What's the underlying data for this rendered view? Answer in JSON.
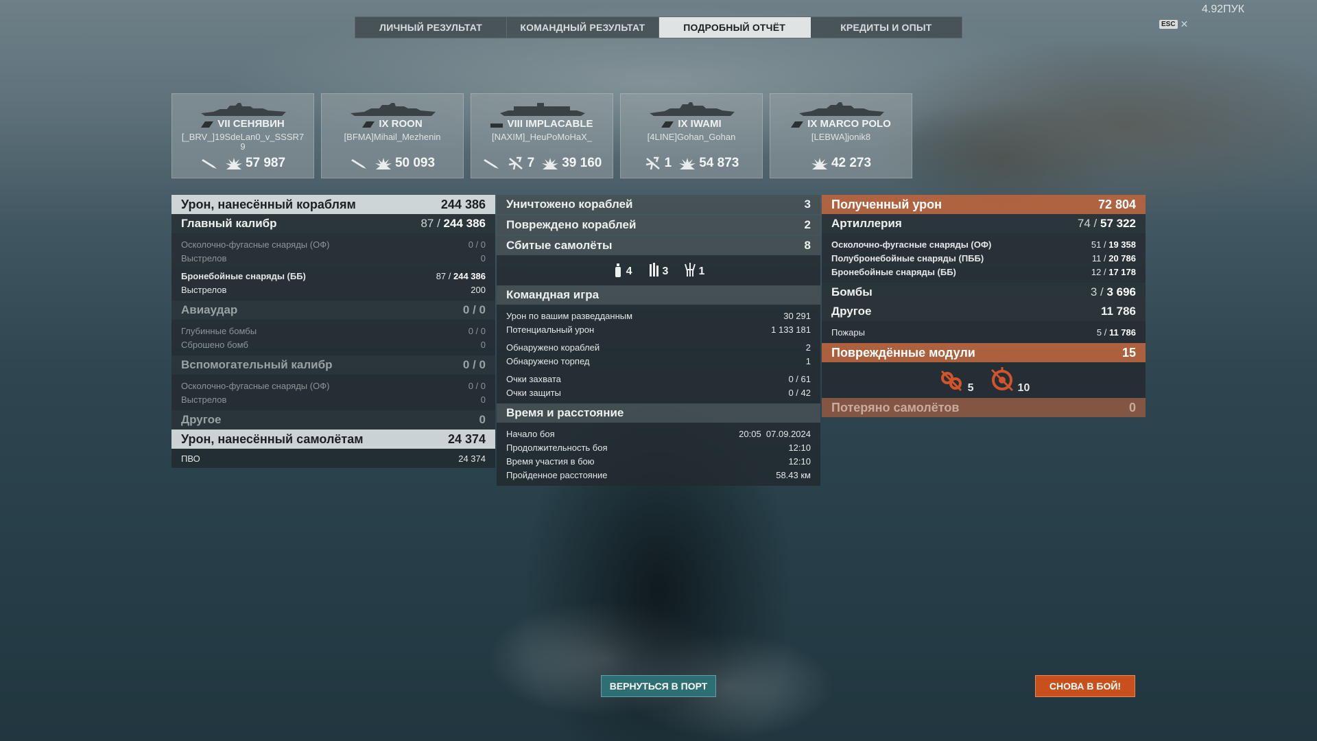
{
  "version": "4.92ПУК",
  "tabs": [
    {
      "label": "ЛИЧНЫЙ РЕЗУЛЬТАТ"
    },
    {
      "label": "КОМАНДНЫЙ РЕЗУЛЬТАТ"
    },
    {
      "label": "ПОДРОБНЫЙ ОТЧЁТ"
    },
    {
      "label": "КРЕДИТЫ И ОПЫТ"
    }
  ],
  "esc_label": "ESC",
  "ships": [
    {
      "name": "VII СЕНЯВИН",
      "player": "[_BRV_]19SdeLan0_v_SSSR79",
      "torpedo": "",
      "planes": "",
      "damage": "57 987"
    },
    {
      "name": "IX ROON",
      "player": "[BFMA]Mihail_Mezhenin",
      "torpedo": "",
      "planes": "",
      "damage": "50 093"
    },
    {
      "name": "VIII IMPLACABLE",
      "player": "[NAXIM]_HeuPoMoHaX_",
      "torpedo": "",
      "planes": "7",
      "damage": "39 160"
    },
    {
      "name": "IX IWAMI",
      "player": "[4LINE]Gohan_Gohan",
      "torpedo": "",
      "planes": "1",
      "damage": "54 873"
    },
    {
      "name": "IX MARCO POLO",
      "player": "[LEBWA]jonik8",
      "torpedo": "",
      "planes": "",
      "damage": "42 273"
    }
  ],
  "left": {
    "damage_ships_label": "Урон, нанесённый кораблям",
    "damage_ships_value": "244 386",
    "main_caliber_label": "Главный калибр",
    "main_caliber_hits": "87",
    "main_caliber_damage": "244 386",
    "he_label": "Осколочно-фугасные снаряды (ОФ)",
    "he_value": "0 / 0",
    "he_shots_label": "Выстрелов",
    "he_shots_value": "0",
    "ap_label": "Бронебойные снаряды (ББ)",
    "ap_hits": "87",
    "ap_damage": "244 386",
    "ap_shots_label": "Выстрелов",
    "ap_shots_value": "200",
    "airstrike_label": "Авиаудар",
    "airstrike_value": "0 / 0",
    "depth_label": "Глубинные бомбы",
    "depth_value": "0 / 0",
    "bombs_dropped_label": "Сброшено бомб",
    "bombs_dropped_value": "0",
    "secondary_label": "Вспомогательный калибр",
    "secondary_value": "0 / 0",
    "sec_he_label": "Осколочно-фугасные снаряды (ОФ)",
    "sec_he_value": "0 / 0",
    "sec_shots_label": "Выстрелов",
    "sec_shots_value": "0",
    "other_label": "Другое",
    "other_value": "0",
    "damage_planes_label": "Урон, нанесённый самолётам",
    "damage_planes_value": "24 374",
    "aa_label": "ПВО",
    "aa_value": "24 374"
  },
  "middle": {
    "destroyed_label": "Уничтожено кораблей",
    "destroyed_value": "3",
    "damaged_label": "Повреждено кораблей",
    "damaged_value": "2",
    "planes_label": "Сбитые самолёты",
    "planes_value": "8",
    "plane_types": [
      {
        "count": "4"
      },
      {
        "count": "3"
      },
      {
        "count": "1"
      }
    ],
    "teamplay_label": "Командная игра",
    "spotting_damage_label": "Урон по вашим разведданным",
    "spotting_damage_value": "30 291",
    "potential_label": "Потенциальный урон",
    "potential_value": "1 133 181",
    "spotted_ships_label": "Обнаружено кораблей",
    "spotted_ships_value": "2",
    "spotted_torps_label": "Обнаружено торпед",
    "spotted_torps_value": "1",
    "capture_label": "Очки захвата",
    "capture_value": "0 / 61",
    "defense_label": "Очки защиты",
    "defense_value": "0 / 42",
    "time_label": "Время и расстояние",
    "start_label": "Начало боя",
    "start_value": "20:05  07.09.2024",
    "duration_label": "Продолжительность боя",
    "duration_value": "12:10",
    "participation_label": "Время участия в бою",
    "participation_value": "12:10",
    "distance_label": "Пройденное расстояние",
    "distance_value": "58.43 км"
  },
  "right": {
    "received_label": "Полученный урон",
    "received_value": "72 804",
    "artillery_label": "Артиллерия",
    "artillery_hits": "74",
    "artillery_damage": "57 322",
    "he_label": "Осколочно-фугасные снаряды (ОФ)",
    "he_hits": "51",
    "he_damage": "19 358",
    "sap_label": "Полубронебойные снаряды (ПББ)",
    "sap_hits": "11",
    "sap_damage": "20 786",
    "ap_label": "Бронебойные снаряды (ББ)",
    "ap_hits": "12",
    "ap_damage": "17 178",
    "bombs_label": "Бомбы",
    "bombs_hits": "3",
    "bombs_damage": "3 696",
    "other_label": "Другое",
    "other_value": "11 786",
    "fires_label": "Пожары",
    "fires_hits": "5",
    "fires_damage": "11 786",
    "modules_label": "Повреждённые модули",
    "modules_value": "15",
    "module_counts": [
      {
        "count": "5"
      },
      {
        "count": "10"
      }
    ],
    "planes_lost_label": "Потеряно самолётов",
    "planes_lost_value": "0"
  },
  "buttons": {
    "port": "ВЕРНУТЬСЯ В ПОРТ",
    "battle": "СНОВА В БОЙ!"
  },
  "colors": {
    "accent_orange": "#c7501d",
    "accent_teal": "#2e6f73",
    "header_orange": "#ba643c"
  }
}
